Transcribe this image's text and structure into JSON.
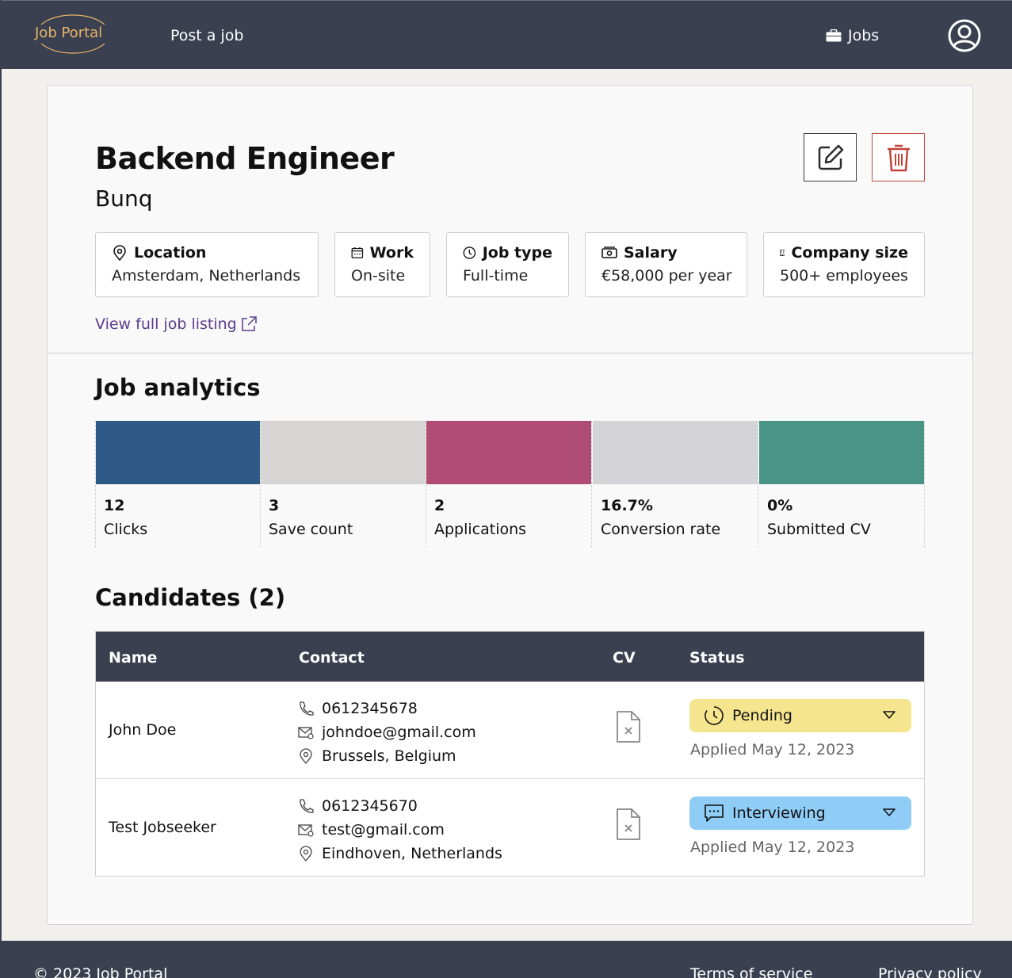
{
  "nav": {
    "logo": "Job Portal",
    "post_job": "Post a job",
    "jobs": "Jobs"
  },
  "job": {
    "title": "Backend Engineer",
    "company": "Bunq",
    "info": [
      {
        "label": "Location",
        "value": "Amsterdam, Netherlands",
        "icon": "map-pin-icon"
      },
      {
        "label": "Work",
        "value": "On-site",
        "icon": "calendar-icon"
      },
      {
        "label": "Job type",
        "value": "Full-time",
        "icon": "clock-icon"
      },
      {
        "label": "Salary",
        "value": "€58,000 per year",
        "icon": "money-icon"
      },
      {
        "label": "Company size",
        "value": "500+ employees",
        "icon": "building-icon"
      }
    ],
    "listing_link": "View full job listing"
  },
  "analytics": {
    "title": "Job analytics",
    "metrics": [
      {
        "value": "12",
        "label": "Clicks",
        "color": "#2e5885"
      },
      {
        "value": "3",
        "label": "Save count",
        "color": "#d6d5d3"
      },
      {
        "value": "2",
        "label": "Applications",
        "color": "#b04d74"
      },
      {
        "value": "16.7%",
        "label": "Conversion rate",
        "color": "#d4d4d8"
      },
      {
        "value": "0%",
        "label": "Submitted CV",
        "color": "#4a9485"
      }
    ]
  },
  "candidates": {
    "title": "Candidates (2)",
    "headers": [
      "Name",
      "Contact",
      "CV",
      "Status"
    ],
    "rows": [
      {
        "name": "John Doe",
        "phone": "0612345678",
        "email": "johndoe@gmail.com",
        "location": "Brussels, Belgium",
        "status": "Pending",
        "applied": "Applied May 12, 2023"
      },
      {
        "name": "Test Jobseeker",
        "phone": "0612345670",
        "email": "test@gmail.com",
        "location": "Eindhoven, Netherlands",
        "status": "Interviewing",
        "applied": "Applied May 12, 2023"
      }
    ]
  },
  "footer": {
    "copyright": "© 2023 Job Portal",
    "terms": "Terms of service",
    "privacy": "Privacy policy"
  },
  "colors": {
    "nav_bg": "#3a404f",
    "pending": "#f5e58e",
    "interviewing": "#8fcdf6",
    "link": "#5b3c8c",
    "logo": "#e8b56a"
  }
}
